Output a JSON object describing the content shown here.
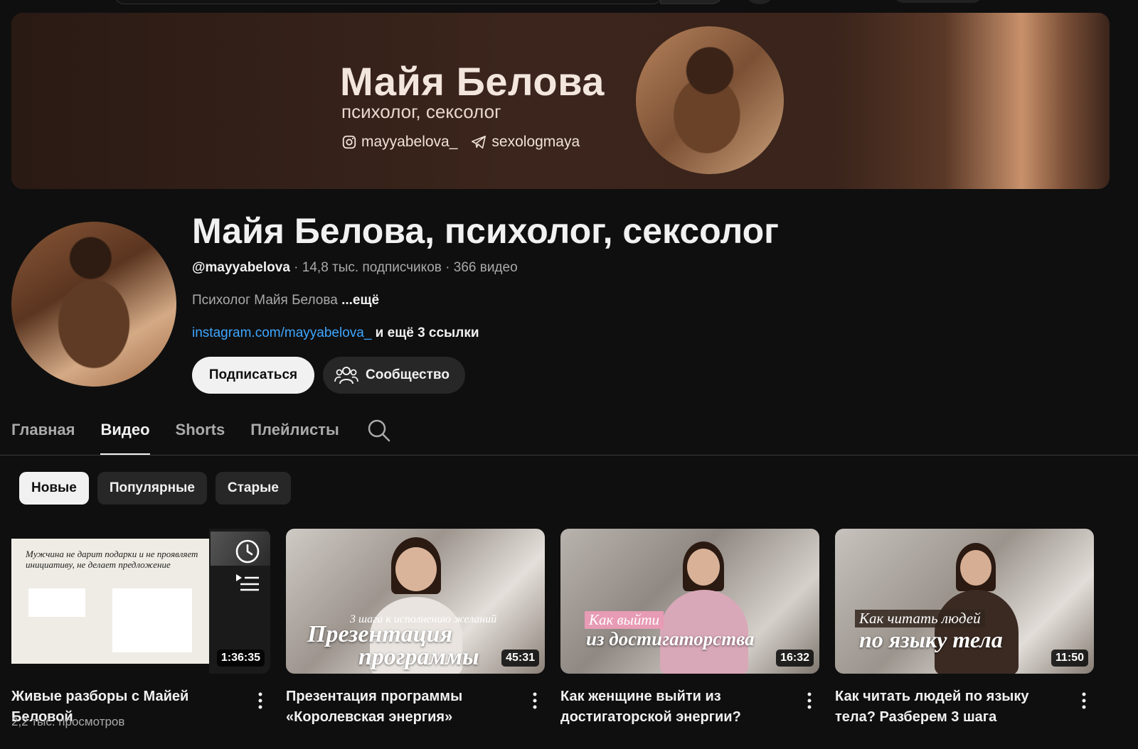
{
  "banner": {
    "title": "Майя Белова",
    "subtitle": "психолог, сексолог",
    "instagram": "mayyabelova_",
    "telegram": "sexologmaya"
  },
  "channel": {
    "name": "Майя Белова, психолог, сексолог",
    "handle": "@mayyabelova",
    "meta_rest": " · 14,8 тыс. подписчиков · 366 видео",
    "description": "Психолог Майя Белова ",
    "description_more": "...ещё",
    "link": "instagram.com/mayyabelova_",
    "link_more": " и ещё 3 ссылки",
    "subscribe_label": "Подписаться",
    "community_label": "Сообщество"
  },
  "tabs": [
    {
      "label": "Главная",
      "active": false
    },
    {
      "label": "Видео",
      "active": true
    },
    {
      "label": "Shorts",
      "active": false
    },
    {
      "label": "Плейлисты",
      "active": false
    }
  ],
  "chips": [
    {
      "label": "Новые",
      "active": true
    },
    {
      "label": "Популярные",
      "active": false
    },
    {
      "label": "Старые",
      "active": false
    }
  ],
  "videos": [
    {
      "title": "Живые разборы с Майей Беловой",
      "views": "2,2 тыс. просмотров",
      "duration": "1:36:35",
      "slide_heading": "Мужчина не дарит подарки и не проявляет инициативу, не делает предложение"
    },
    {
      "title": "Презентация программы «Королевская энергия»",
      "duration": "45:31",
      "overlay_tag": "3 шага к исполнению желаний",
      "overlay_line1": "Презентация",
      "overlay_line2": "программы"
    },
    {
      "title": "Как женщине выйти из достигаторской энергии?",
      "duration": "16:32",
      "overlay_tag": "Как выйти",
      "overlay_line1": "из достигаторства"
    },
    {
      "title": "Как читать людей по языку тела? Разберем 3 шага",
      "duration": "11:50",
      "overlay_tag": "Как читать людей",
      "overlay_line1": "по языку тела"
    }
  ],
  "colors": {
    "background": "#0f0f0f",
    "text": "#f1f1f1",
    "muted": "#aaaaaa",
    "link": "#3ea6ff",
    "chip_bg": "#272727"
  }
}
